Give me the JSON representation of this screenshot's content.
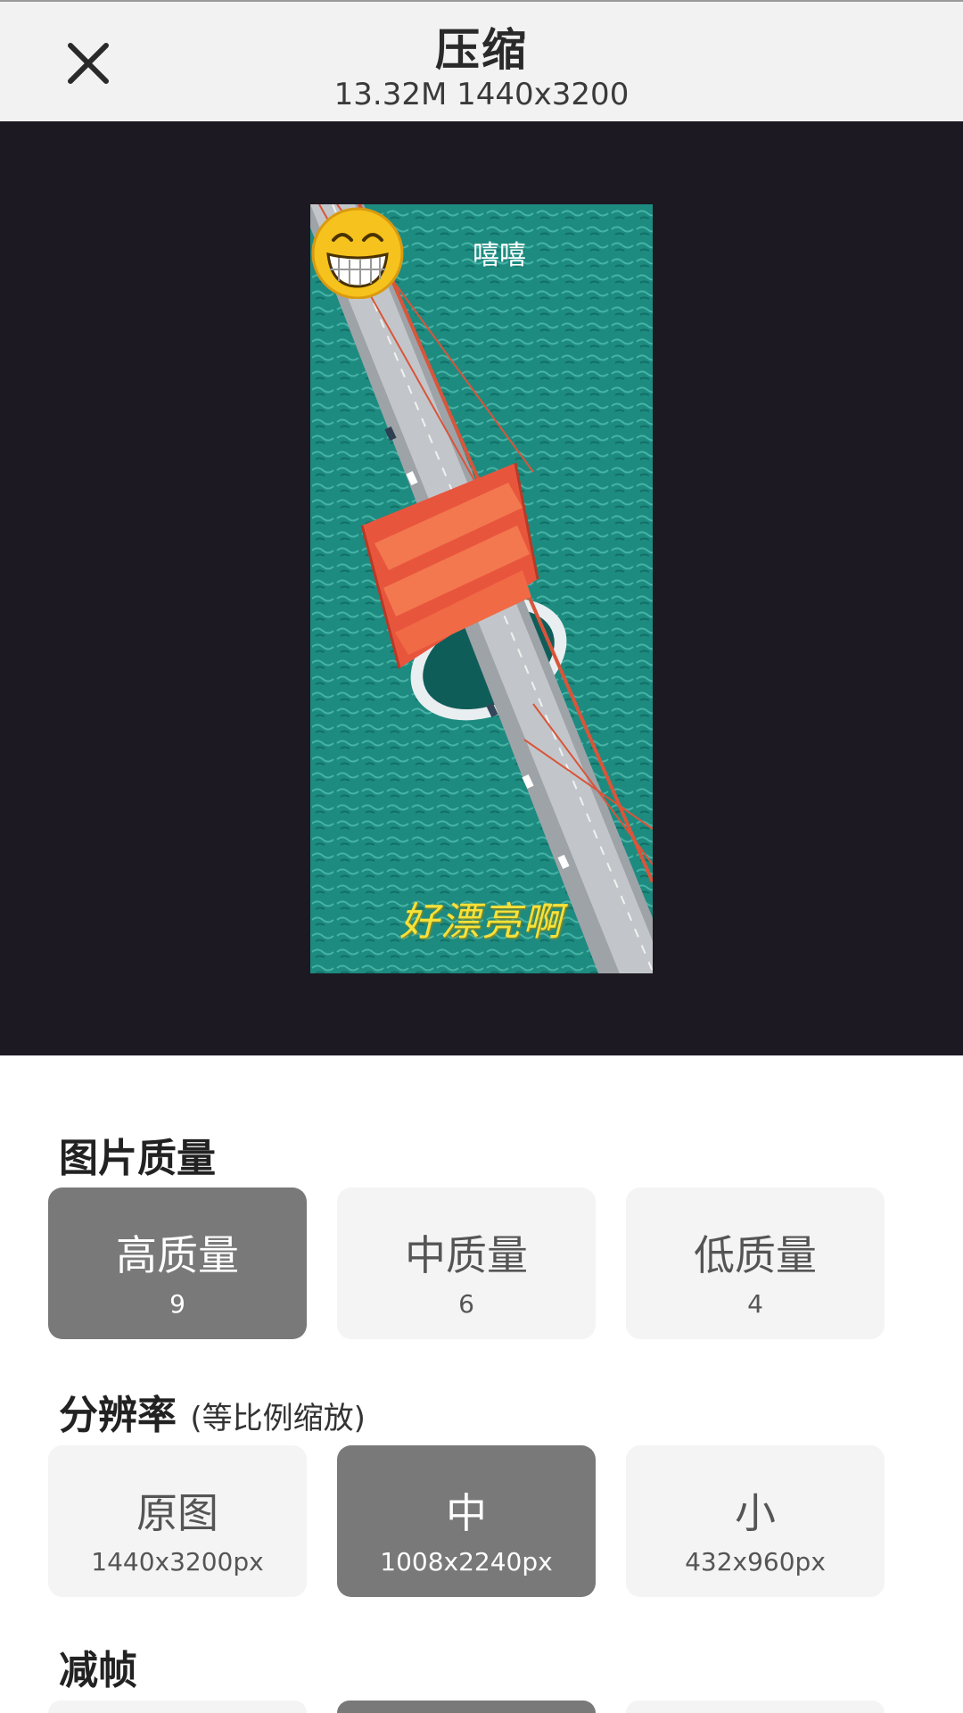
{
  "header": {
    "title": "压缩",
    "subtitle": "13.32M 1440x3200",
    "close_icon": "close-icon"
  },
  "preview": {
    "caption_top": "嘻嘻",
    "caption_bottom": "好漂亮啊",
    "sticker_icon": "grinning-face-icon",
    "photo_description_icon": "bridge-photo"
  },
  "quality": {
    "title": "图片质量",
    "options": [
      {
        "label": "高质量",
        "value": "9",
        "selected": true
      },
      {
        "label": "中质量",
        "value": "6",
        "selected": false
      },
      {
        "label": "低质量",
        "value": "4",
        "selected": false
      }
    ]
  },
  "resolution": {
    "title": "分辨率",
    "note": "(等比例缩放)",
    "options": [
      {
        "label": "原图",
        "value": "1440x3200px",
        "selected": false
      },
      {
        "label": "中",
        "value": "1008x2240px",
        "selected": true
      },
      {
        "label": "小",
        "value": "432x960px",
        "selected": false
      }
    ]
  },
  "framerate": {
    "title": "减帧"
  },
  "colors": {
    "header_bg": "#f2f2f2",
    "preview_bg": "#1c1922",
    "selected_option": "#797979",
    "unselected_option": "#f4f4f4"
  }
}
